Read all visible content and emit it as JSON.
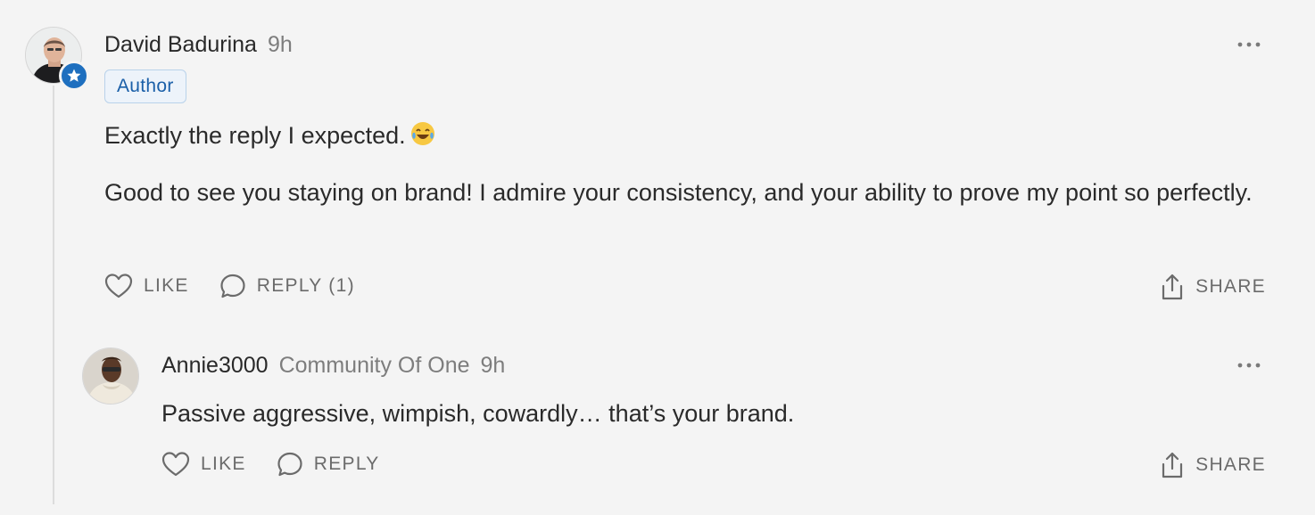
{
  "colors": {
    "background": "#f4f4f4",
    "accent": "#1e6fbf",
    "muted": "#6b6b6b"
  },
  "comment": {
    "author": "David Badurina",
    "time": "9h",
    "badge": "Author",
    "paragraphs": [
      "Exactly the reply I expected.",
      "Good to see you staying on brand! I admire your consistency, and your ability to prove my point so perfectly."
    ],
    "emoji_icon": "tears-of-joy-emoji",
    "actions": {
      "like": "LIKE",
      "reply": "REPLY (1)",
      "share": "SHARE"
    }
  },
  "reply": {
    "author": "Annie3000",
    "community": "Community Of One",
    "time": "9h",
    "text": "Passive aggressive, wimpish, cowardly… that’s your brand.",
    "actions": {
      "like": "LIKE",
      "reply": "REPLY",
      "share": "SHARE"
    }
  }
}
